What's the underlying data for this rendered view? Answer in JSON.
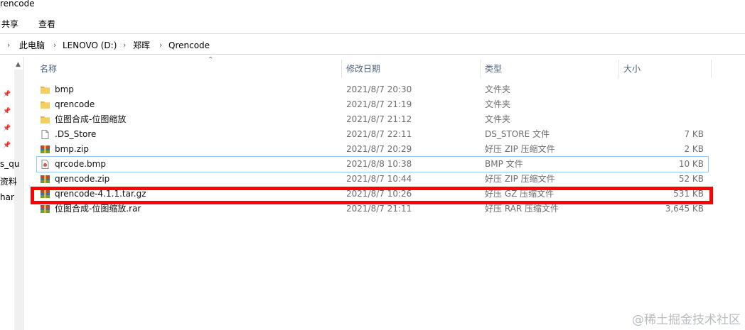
{
  "window": {
    "title": "rencode"
  },
  "ribbon": {
    "tabs": [
      "共享",
      "查看"
    ]
  },
  "address": {
    "crumbs": [
      "此电脑",
      "LENOVO (D:)",
      "郑晖",
      "Qrencode"
    ]
  },
  "nav": {
    "items": [
      "s_qu",
      "资料",
      "har"
    ]
  },
  "columns": {
    "name": "名称",
    "date": "修改日期",
    "type": "类型",
    "size": "大小"
  },
  "files": [
    {
      "name": "bmp",
      "date": "2021/8/7 20:30",
      "type": "文件夹",
      "size": "",
      "icon": "folder-icon"
    },
    {
      "name": "qrencode",
      "date": "2021/8/7 21:19",
      "type": "文件夹",
      "size": "",
      "icon": "folder-icon"
    },
    {
      "name": "位图合成-位图缩放",
      "date": "2021/8/7 21:12",
      "type": "文件夹",
      "size": "",
      "icon": "folder-icon"
    },
    {
      "name": ".DS_Store",
      "date": "2021/8/7 22:11",
      "type": "DS_STORE 文件",
      "size": "7 KB",
      "icon": "file-icon"
    },
    {
      "name": "bmp.zip",
      "date": "2021/8/7 20:29",
      "type": "好压 ZIP 压缩文件",
      "size": "2 KB",
      "icon": "archive-icon"
    },
    {
      "name": "qrcode.bmp",
      "date": "2021/8/8 10:38",
      "type": "BMP 文件",
      "size": "10 KB",
      "icon": "image-file-icon"
    },
    {
      "name": "qrencode.zip",
      "date": "2021/8/7 10:44",
      "type": "好压 ZIP 压缩文件",
      "size": "52 KB",
      "icon": "archive-icon"
    },
    {
      "name": "qrencode-4.1.1.tar.gz",
      "date": "2021/8/7 10:26",
      "type": "好压 GZ 压缩文件",
      "size": "531 KB",
      "icon": "archive-icon"
    },
    {
      "name": "位图合成-位图缩放.rar",
      "date": "2021/8/7 21:11",
      "type": "好压 RAR 压缩文件",
      "size": "3,645 KB",
      "icon": "archive-icon"
    }
  ],
  "watermark": "@稀土掘金技术社区",
  "colors": {
    "highlight": "#ff0000",
    "selection": "#99c9ef",
    "folder": "#e8b64a"
  }
}
